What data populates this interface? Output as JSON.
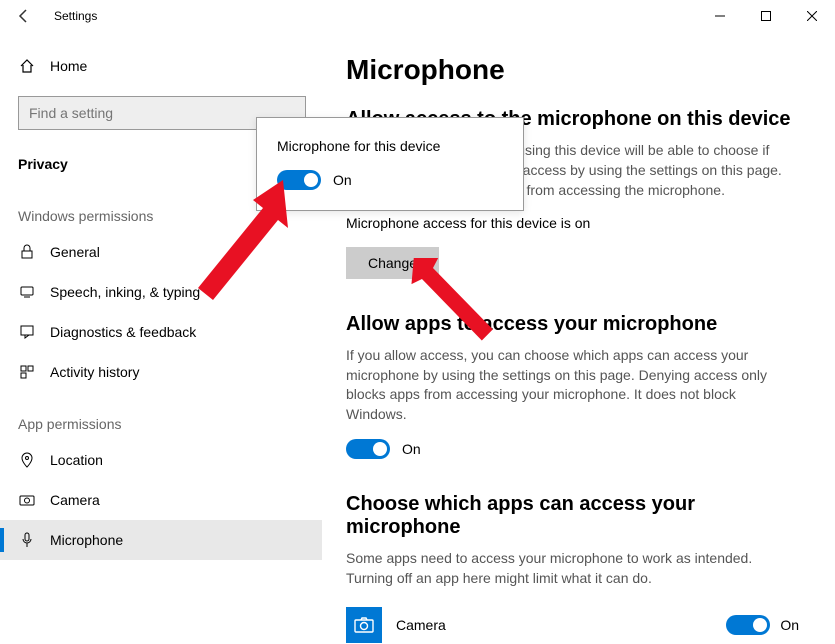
{
  "window": {
    "title": "Settings"
  },
  "sidebar": {
    "home": "Home",
    "search_placeholder": "Find a setting",
    "category": "Privacy",
    "group1_label": "Windows permissions",
    "group1": [
      {
        "label": "General"
      },
      {
        "label": "Speech, inking, & typing"
      },
      {
        "label": "Diagnostics & feedback"
      },
      {
        "label": "Activity history"
      }
    ],
    "group2_label": "App permissions",
    "group2": [
      {
        "label": "Location"
      },
      {
        "label": "Camera"
      },
      {
        "label": "Microphone"
      }
    ]
  },
  "page": {
    "title": "Microphone",
    "sec1_h": "Allow access to the microphone on this device",
    "sec1_p": "If you allow access, people using this device will be able to choose if their apps have microphone access by using the settings on this page. Denying access blocks apps from accessing the microphone.",
    "status": "Microphone access for this device is on",
    "change": "Change",
    "sec2_h": "Allow apps to access your microphone",
    "sec2_p": "If you allow access, you can choose which apps can access your microphone by using the settings on this page. Denying access only blocks apps from accessing your microphone. It does not block Windows.",
    "toggle_on": "On",
    "sec3_h": "Choose which apps can access your microphone",
    "sec3_p": "Some apps need to access your microphone to work as intended. Turning off an app here might limit what it can do.",
    "app1": "Camera",
    "app1_state": "On"
  },
  "popup": {
    "title": "Microphone for this device",
    "state": "On"
  }
}
